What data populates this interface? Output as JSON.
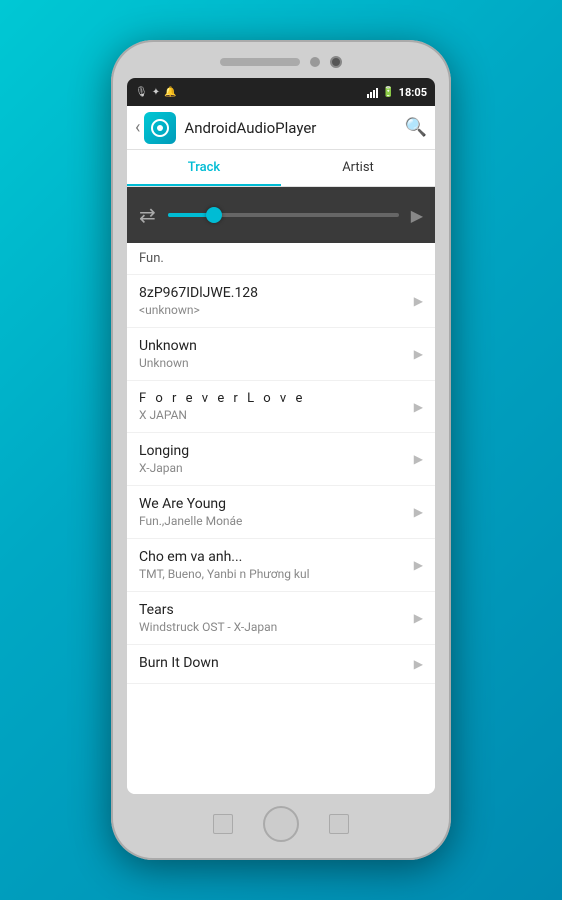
{
  "background": "#00c0d4",
  "status_bar": {
    "time": "18:05",
    "icons_left": [
      "mic-icon",
      "bluetooth-icon",
      "alarm-icon"
    ],
    "icons_right": [
      "wifi-icon",
      "signal-icon",
      "battery-icon"
    ]
  },
  "toolbar": {
    "app_name": "AndroidAudioPlayer",
    "back_label": "‹",
    "search_label": "🔍"
  },
  "tabs": [
    {
      "label": "Track",
      "active": true
    },
    {
      "label": "Artist",
      "active": false
    }
  ],
  "seekbar": {
    "shuffle_icon": "⇄",
    "progress_percent": 20
  },
  "tracks": [
    {
      "title": "Fun.",
      "artist": "",
      "is_section_label": true
    },
    {
      "title": "8zP967IDlJWE.128",
      "artist": "<unknown>"
    },
    {
      "title": "Unknown",
      "artist": "Unknown"
    },
    {
      "title": "F o r e v e r   L o v e",
      "artist": "X JAPAN"
    },
    {
      "title": "Longing",
      "artist": "X-Japan"
    },
    {
      "title": "We Are Young",
      "artist": "Fun.,Janelle Monáe"
    },
    {
      "title": "Cho em va anh...",
      "artist": "TMT, Bueno, Yanbi n Phương kul"
    },
    {
      "title": "Tears",
      "artist": "Windstruck OST - X-Japan"
    },
    {
      "title": "Burn It Down",
      "artist": ""
    }
  ]
}
